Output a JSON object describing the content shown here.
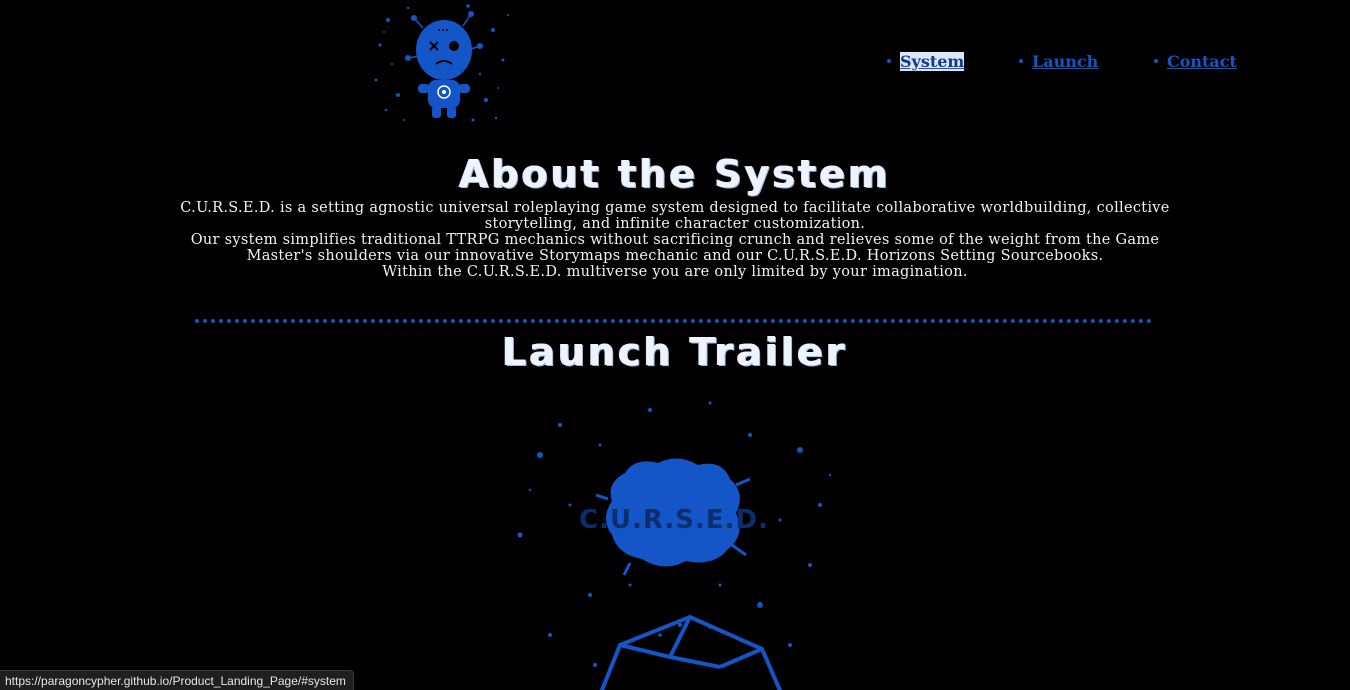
{
  "logo": {
    "icon": "voodoo-doll-icon",
    "color": "#1456c8"
  },
  "nav": {
    "items": [
      {
        "label": "System",
        "active": true
      },
      {
        "label": "Launch",
        "active": false
      },
      {
        "label": "Contact",
        "active": false
      }
    ]
  },
  "about": {
    "title": "About the System",
    "paragraphs": [
      "C.U.R.S.E.D. is a setting agnostic universal roleplaying game system designed to facilitate collaborative worldbuilding, collective storytelling, and infinite character customization.",
      "Our system simplifies traditional TTRPG mechanics without sacrificing crunch and relieves some of the weight from the Game Master's shoulders via our innovative Storymaps mechanic and our C.U.R.S.E.D. Horizons Setting Sourcebooks.",
      "Within the C.U.R.S.E.D. multiverse you are only limited by your imagination."
    ]
  },
  "trailer": {
    "title": "Launch Trailer",
    "logo_text": "C.U.R.S.E.D.",
    "icon": "dice-icon"
  },
  "status_bar": {
    "url": "https://paragoncypher.github.io/Product_Landing_Page/#system"
  },
  "colors": {
    "accent": "#1456c8",
    "background": "#000000",
    "text": "#f2f2f2"
  }
}
